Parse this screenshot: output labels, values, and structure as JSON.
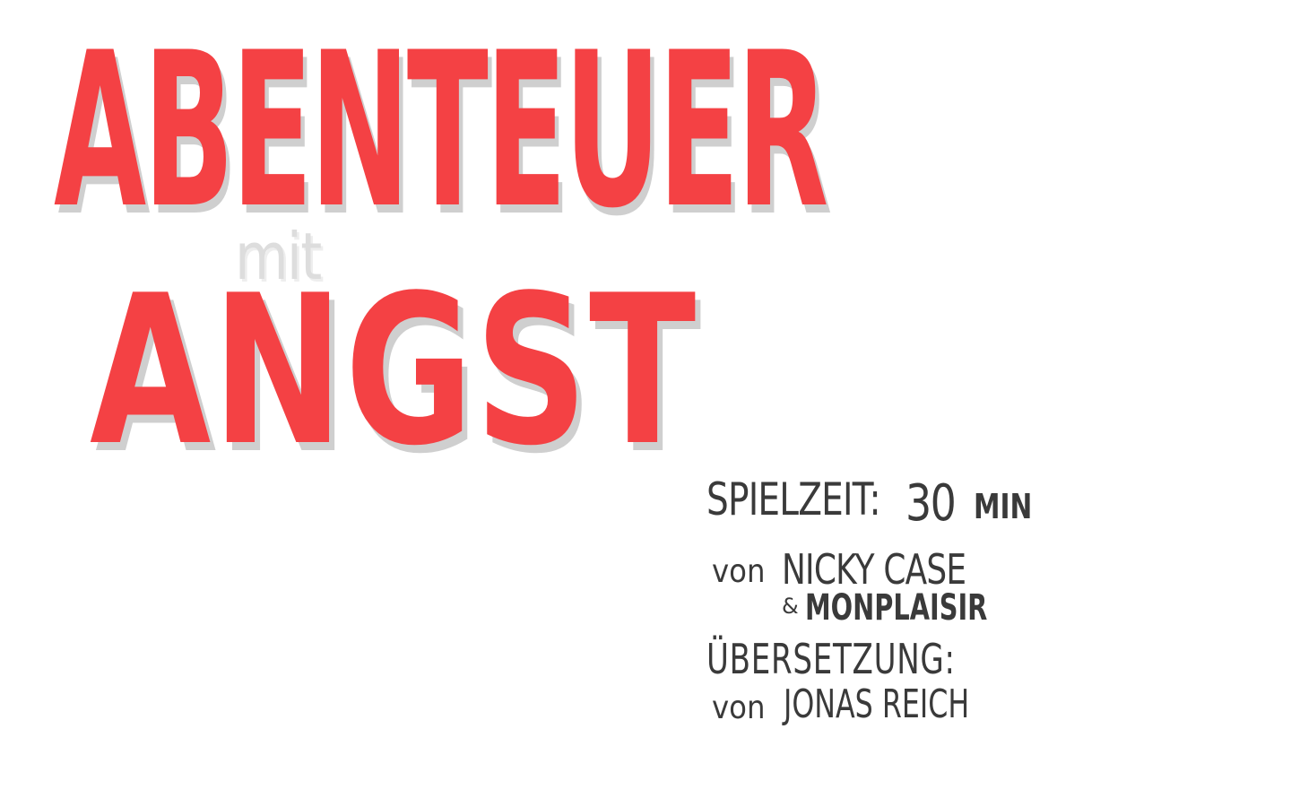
{
  "title": {
    "main": "ABENTEUER",
    "connector": "mit",
    "sub": "ANGST"
  },
  "credits": {
    "playtime_label": "SPIELZEIT:",
    "playtime_value": "30",
    "playtime_unit": "MIN",
    "author_prefix": "von",
    "author_name": "NICKY CASE",
    "coauthor_prefix": "&",
    "coauthor_name": "MONPLAISIR",
    "translation_label": "ÜBERSETZUNG:",
    "translator_prefix": "von",
    "translator_name": "JONAS REICH"
  },
  "colors": {
    "title": "#f44144",
    "title_shadow": "#cfcfcf",
    "connector": "#dddddd",
    "text": "#3a3a3a",
    "background": "#ffffff"
  }
}
